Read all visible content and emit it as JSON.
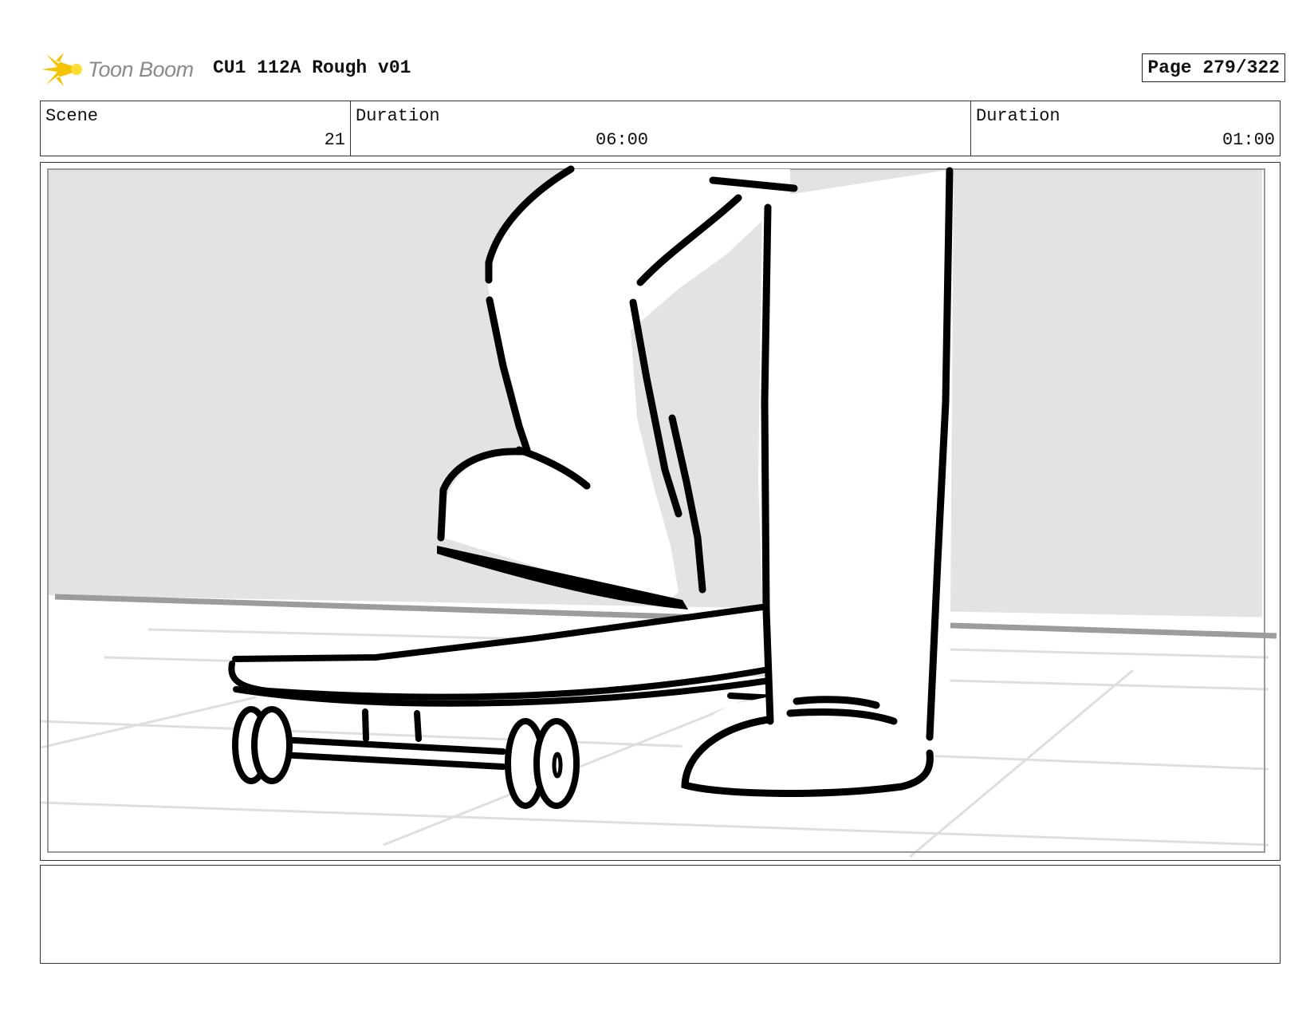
{
  "header": {
    "logo_text": "Toon Boom",
    "title": "CU1 112A Rough v01",
    "page": "Page 279/322"
  },
  "info": {
    "scene_label": "Scene",
    "scene_value": "21",
    "duration1_label": "Duration",
    "duration1_value": "06:00",
    "duration2_label": "Duration",
    "duration2_value": "01:00"
  },
  "colors": {
    "logo_accent": "#f5c400",
    "wall": "#e3e3e3",
    "floor_line": "#dcdcdc",
    "ink": "#000000"
  },
  "notes": ""
}
